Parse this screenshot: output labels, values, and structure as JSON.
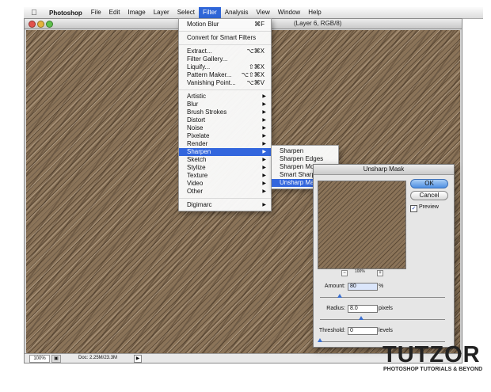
{
  "menubar": {
    "apple": "",
    "app": "Photoshop",
    "items": [
      "File",
      "Edit",
      "Image",
      "Layer",
      "Select",
      "Filter",
      "Analysis",
      "View",
      "Window",
      "Help"
    ],
    "active": "Filter"
  },
  "document": {
    "title": "(Layer 6, RGB/8)",
    "status": {
      "zoom": "100%",
      "doc": "Doc: 2.25M/23.3M"
    }
  },
  "filter_menu": {
    "last_filter": {
      "label": "Motion Blur",
      "shortcut": "⌘F"
    },
    "convert": "Convert for Smart Filters",
    "group1": [
      {
        "label": "Extract...",
        "shortcut": "⌥⌘X"
      },
      {
        "label": "Filter Gallery...",
        "shortcut": ""
      },
      {
        "label": "Liquify...",
        "shortcut": "⇧⌘X"
      },
      {
        "label": "Pattern Maker...",
        "shortcut": "⌥⇧⌘X"
      },
      {
        "label": "Vanishing Point...",
        "shortcut": "⌥⌘V"
      }
    ],
    "submenus": [
      "Artistic",
      "Blur",
      "Brush Strokes",
      "Distort",
      "Noise",
      "Pixelate",
      "Render",
      "Sharpen",
      "Sketch",
      "Stylize",
      "Texture",
      "Video",
      "Other"
    ],
    "highlighted": "Sharpen",
    "digimarc": "Digimarc"
  },
  "sharpen_menu": {
    "items": [
      "Sharpen",
      "Sharpen Edges",
      "Sharpen More",
      "Smart Sharpen...",
      "Unsharp Mask..."
    ],
    "highlighted": "Unsharp Mask..."
  },
  "dialog": {
    "title": "Unsharp Mask",
    "ok": "OK",
    "cancel": "Cancel",
    "preview_label": "Preview",
    "preview_checked": true,
    "zoom": "100%",
    "zoom_out": "−",
    "zoom_in": "+",
    "amount": {
      "label": "Amount:",
      "value": "80",
      "unit": "%",
      "level": 0.16
    },
    "radius": {
      "label": "Radius:",
      "value": "8.0",
      "unit": "pixels",
      "level": 0.33
    },
    "threshold": {
      "label": "Threshold:",
      "value": "0",
      "unit": "levels",
      "level": 0.0
    }
  },
  "watermark": {
    "logo": "TUTZOR",
    "tagline": "PHOTOSHOP TUTORIALS & BEYOND"
  },
  "colors": {
    "highlight": "#3366dd",
    "texture": "#8a7358"
  }
}
